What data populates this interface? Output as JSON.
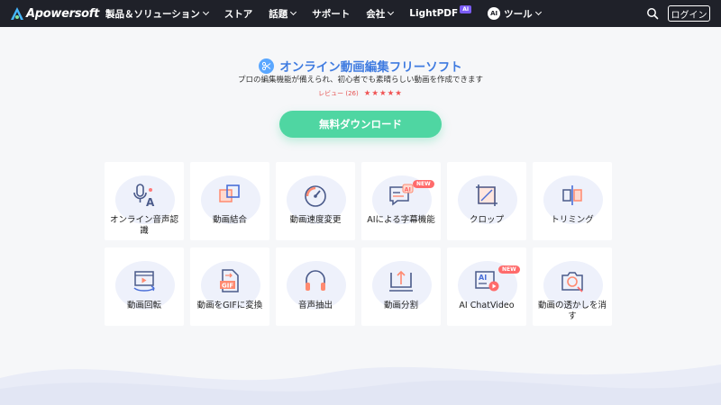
{
  "nav": {
    "brand": "Apowersoft",
    "items": [
      {
        "label": "製品＆ソリューション",
        "has_menu": true
      },
      {
        "label": "ストア",
        "has_menu": false
      },
      {
        "label": "話題",
        "has_menu": true
      },
      {
        "label": "サポート",
        "has_menu": false
      },
      {
        "label": "会社",
        "has_menu": true
      },
      {
        "label": "LightPDF",
        "badge": "AI"
      },
      {
        "label": "ツール",
        "has_menu": true
      }
    ],
    "tools_icon_text": "AI",
    "login_label": "ログイン"
  },
  "hero": {
    "title": "オンライン動画編集フリーソフト",
    "subtitle": "プロの編集機能が備えられ、初心者でも素晴らしい動画を作成できます",
    "review_text": "レビュー (26)",
    "stars": "★★★★★",
    "download_label": "無料ダウンロード"
  },
  "tools": [
    {
      "label": "オンライン音声認識",
      "icon": "speech-to-text-icon"
    },
    {
      "label": "動画結合",
      "icon": "merge-icon"
    },
    {
      "label": "動画速度変更",
      "icon": "speedometer-icon"
    },
    {
      "label": "AIによる字幕機能",
      "icon": "ai-subtitle-icon",
      "badge": "NEW"
    },
    {
      "label": "クロップ",
      "icon": "crop-icon"
    },
    {
      "label": "トリミング",
      "icon": "trim-icon"
    },
    {
      "label": "動画回転",
      "icon": "rotate-icon"
    },
    {
      "label": "動画をGIFに変換",
      "icon": "gif-icon",
      "gif_text": "GIF"
    },
    {
      "label": "音声抽出",
      "icon": "headphones-icon"
    },
    {
      "label": "動画分割",
      "icon": "split-icon"
    },
    {
      "label": "AI ChatVideo",
      "icon": "ai-chatvideo-icon",
      "badge": "NEW",
      "icon_text": "AI"
    },
    {
      "label": "動画の透かしを消す",
      "icon": "watermark-remove-icon"
    }
  ],
  "colors": {
    "nav_bg": "#1f2129",
    "accent_blue": "#3f7be0",
    "download_green": "#4fd6a2",
    "star_red": "#f05252",
    "badge_red": "#ff6b6b",
    "ai_purple": "#7b5cf6"
  }
}
